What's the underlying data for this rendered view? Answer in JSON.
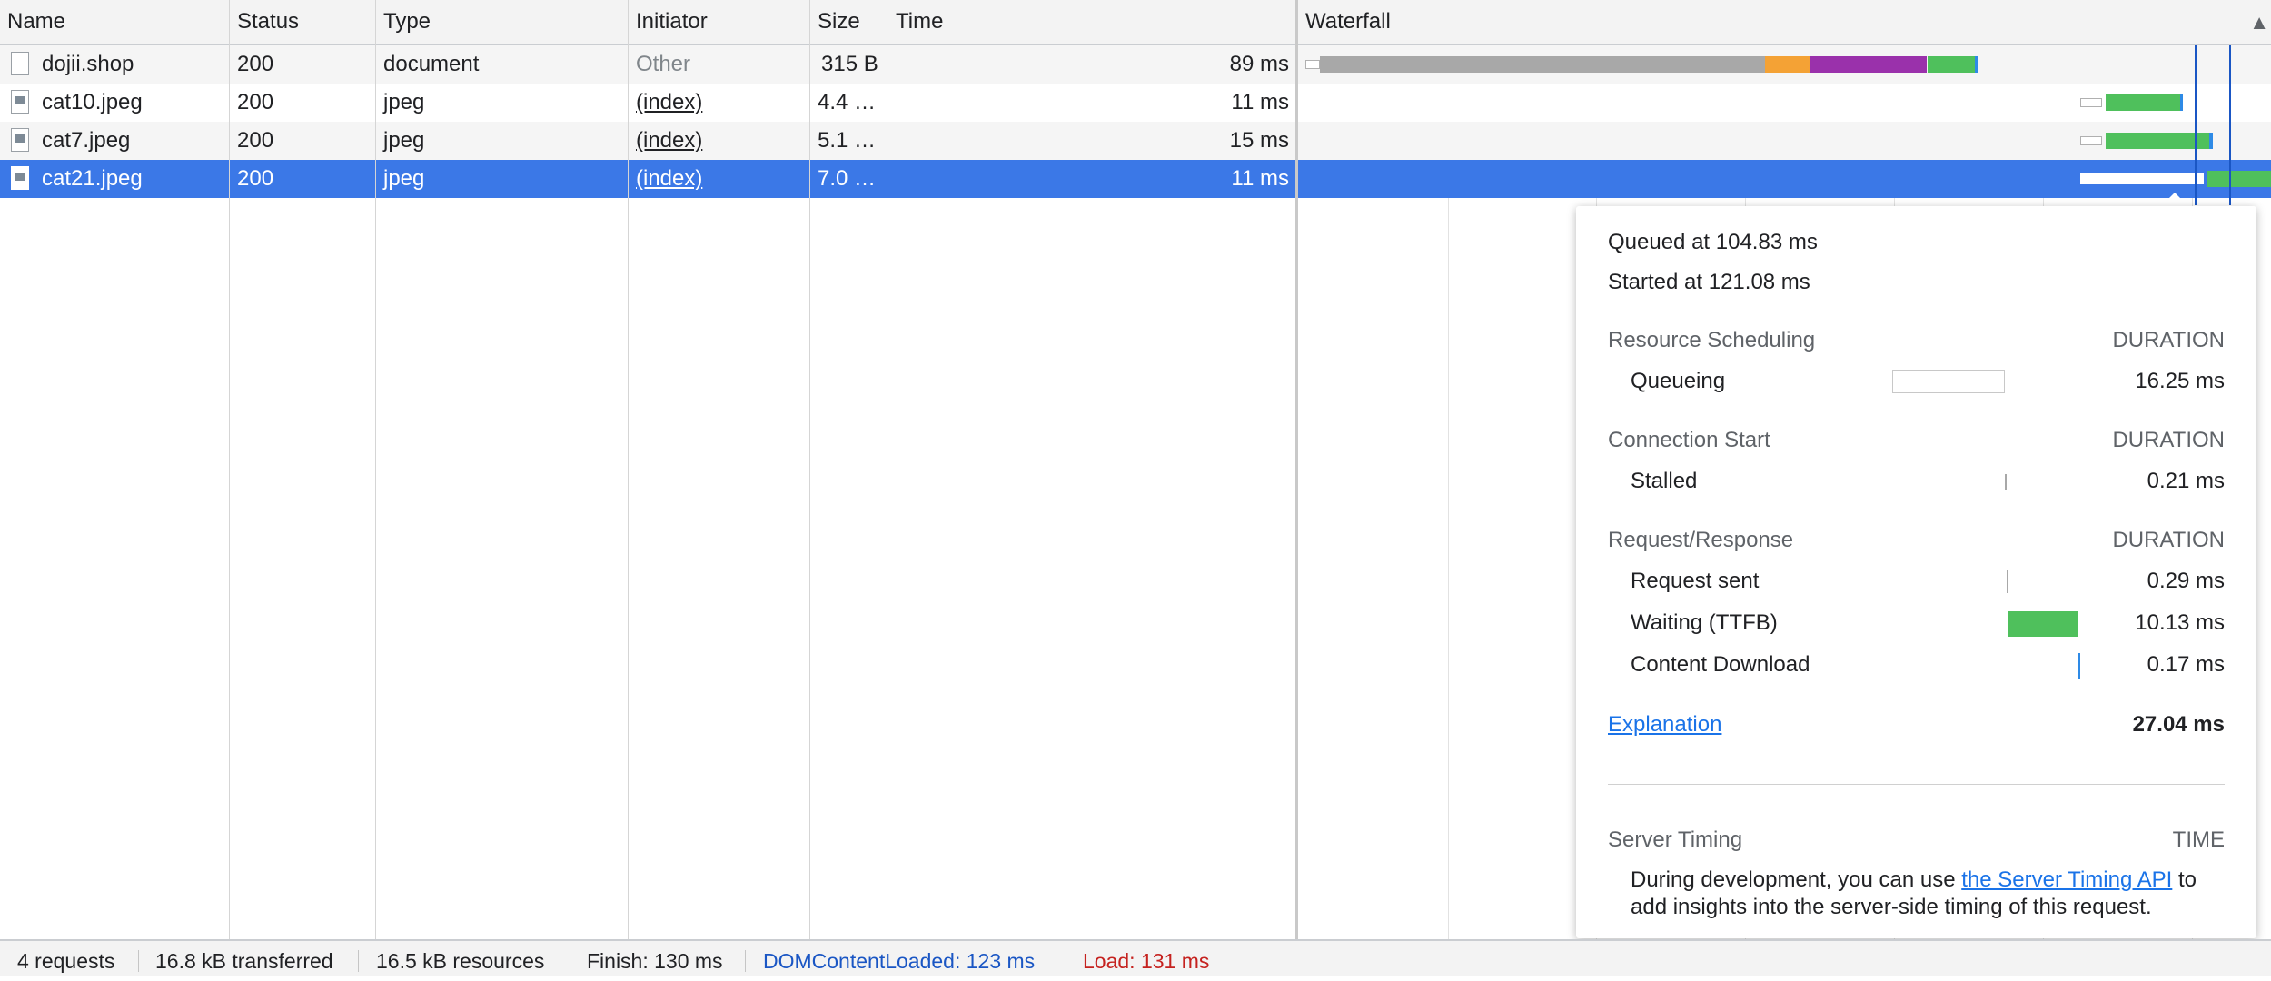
{
  "columns": {
    "name": "Name",
    "status": "Status",
    "type": "Type",
    "initiator": "Initiator",
    "size": "Size",
    "time": "Time",
    "waterfall": "Waterfall"
  },
  "sort_indicator": "▲",
  "rows": [
    {
      "name": "dojii.shop",
      "status": "200",
      "type": "document",
      "initiator": "Other",
      "size": "315 B",
      "time": "89 ms",
      "icon": "document-icon"
    },
    {
      "name": "cat10.jpeg",
      "status": "200",
      "type": "jpeg",
      "initiator": "(index)",
      "size": "4.4 …",
      "time": "11 ms",
      "icon": "image-icon"
    },
    {
      "name": "cat7.jpeg",
      "status": "200",
      "type": "jpeg",
      "initiator": "(index)",
      "size": "5.1 …",
      "time": "15 ms",
      "icon": "image-icon"
    },
    {
      "name": "cat21.jpeg",
      "status": "200",
      "type": "jpeg",
      "initiator": "(index)",
      "size": "7.0 …",
      "time": "11 ms",
      "icon": "image-icon",
      "selected": true
    }
  ],
  "timing_popup": {
    "queued_at": "Queued at 104.83 ms",
    "started_at": "Started at 121.08 ms",
    "resource_scheduling": {
      "title": "Resource Scheduling",
      "duration_label": "DURATION",
      "items": [
        {
          "label": "Queueing",
          "value": "16.25 ms"
        }
      ]
    },
    "connection_start": {
      "title": "Connection Start",
      "duration_label": "DURATION",
      "items": [
        {
          "label": "Stalled",
          "value": "0.21 ms"
        }
      ]
    },
    "request_response": {
      "title": "Request/Response",
      "duration_label": "DURATION",
      "items": [
        {
          "label": "Request sent",
          "value": "0.29 ms"
        },
        {
          "label": "Waiting (TTFB)",
          "value": "10.13 ms"
        },
        {
          "label": "Content Download",
          "value": "0.17 ms"
        }
      ]
    },
    "explanation_link": "Explanation",
    "total": "27.04 ms",
    "server_timing": {
      "title": "Server Timing",
      "time_label": "TIME",
      "text_before": "During development, you can use ",
      "link": "the Server Timing API",
      "text_after_1": " to",
      "text_line2": "add insights into the server-side timing of this request."
    }
  },
  "footer": {
    "requests": "4 requests",
    "transferred": "16.8 kB transferred",
    "resources": "16.5 kB resources",
    "finish": "Finish: 130 ms",
    "dom_content_loaded": "DOMContentLoaded: 123 ms",
    "load": "Load: 131 ms"
  },
  "colors": {
    "selected_row": "#3b78e7",
    "stalled": "#a8a8a8",
    "ssl": "#f4a235",
    "connect": "#9a31ab",
    "ttfb": "#4fc05c",
    "download": "#2e8ae6",
    "dom_content_loaded": "#1a56c4",
    "load": "#c5221f"
  }
}
